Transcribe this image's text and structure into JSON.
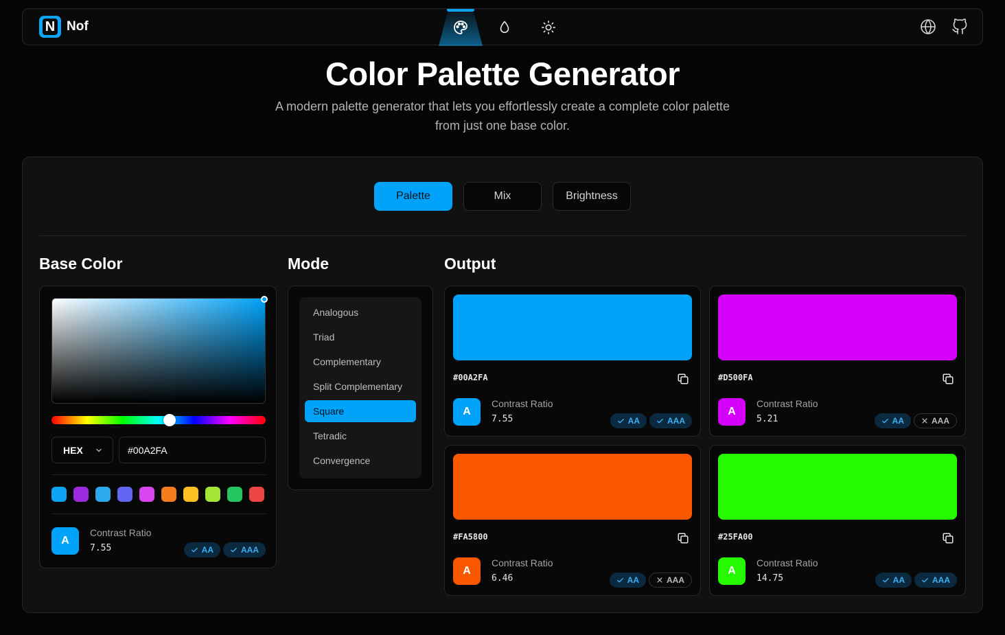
{
  "app": {
    "logo_letter": "N",
    "name": "Nof"
  },
  "nav": {
    "items": [
      {
        "icon": "palette-icon",
        "active": true
      },
      {
        "icon": "droplet-icon",
        "active": false
      },
      {
        "icon": "sun-icon",
        "active": false
      }
    ],
    "right": [
      {
        "icon": "globe-icon"
      },
      {
        "icon": "github-icon"
      }
    ]
  },
  "hero": {
    "title": "Color Palette Generator",
    "subtitle": "A modern palette generator that lets you effortlessly create a complete color palette from just one base color."
  },
  "tabs": [
    {
      "label": "Palette",
      "active": true
    },
    {
      "label": "Mix",
      "active": false
    },
    {
      "label": "Brightness",
      "active": false
    }
  ],
  "base_color": {
    "title": "Base Color",
    "format": "HEX",
    "value": "#00A2FA",
    "hue_position_fraction": 0.55,
    "presets": [
      "#0ea5f5",
      "#9d2ae0",
      "#2ba8ee",
      "#6366f1",
      "#d946ef",
      "#f57c1f",
      "#fbbf24",
      "#a3e635",
      "#22c55e",
      "#ef4444"
    ],
    "contrast": {
      "label": "Contrast Ratio",
      "sample_letter": "A",
      "ratio": "7.55",
      "aa": "AA",
      "aaa": "AAA",
      "aa_pass": true,
      "aaa_pass": true
    }
  },
  "mode": {
    "title": "Mode",
    "items": [
      "Analogous",
      "Triad",
      "Complementary",
      "Split Complementary",
      "Square",
      "Tetradic",
      "Convergence"
    ],
    "selected": "Square"
  },
  "output": {
    "title": "Output",
    "colors": [
      {
        "hex": "#00A2FA",
        "label": "Contrast Ratio",
        "ratio": "7.55",
        "letter": "A",
        "aa": "AA",
        "aaa": "AAA",
        "aa_pass": true,
        "aaa_pass": true
      },
      {
        "hex": "#D500FA",
        "label": "Contrast Ratio",
        "ratio": "5.21",
        "letter": "A",
        "aa": "AA",
        "aaa": "AAA",
        "aa_pass": true,
        "aaa_pass": false
      },
      {
        "hex": "#FA5800",
        "label": "Contrast Ratio",
        "ratio": "6.46",
        "letter": "A",
        "aa": "AA",
        "aaa": "AAA",
        "aa_pass": true,
        "aaa_pass": false
      },
      {
        "hex": "#25FA00",
        "label": "Contrast Ratio",
        "ratio": "14.75",
        "letter": "A",
        "aa": "AA",
        "aaa": "AAA",
        "aa_pass": true,
        "aaa_pass": true
      }
    ]
  },
  "colors": {
    "accent": "#00a2fa",
    "background": "#050505",
    "panel": "#111111"
  }
}
